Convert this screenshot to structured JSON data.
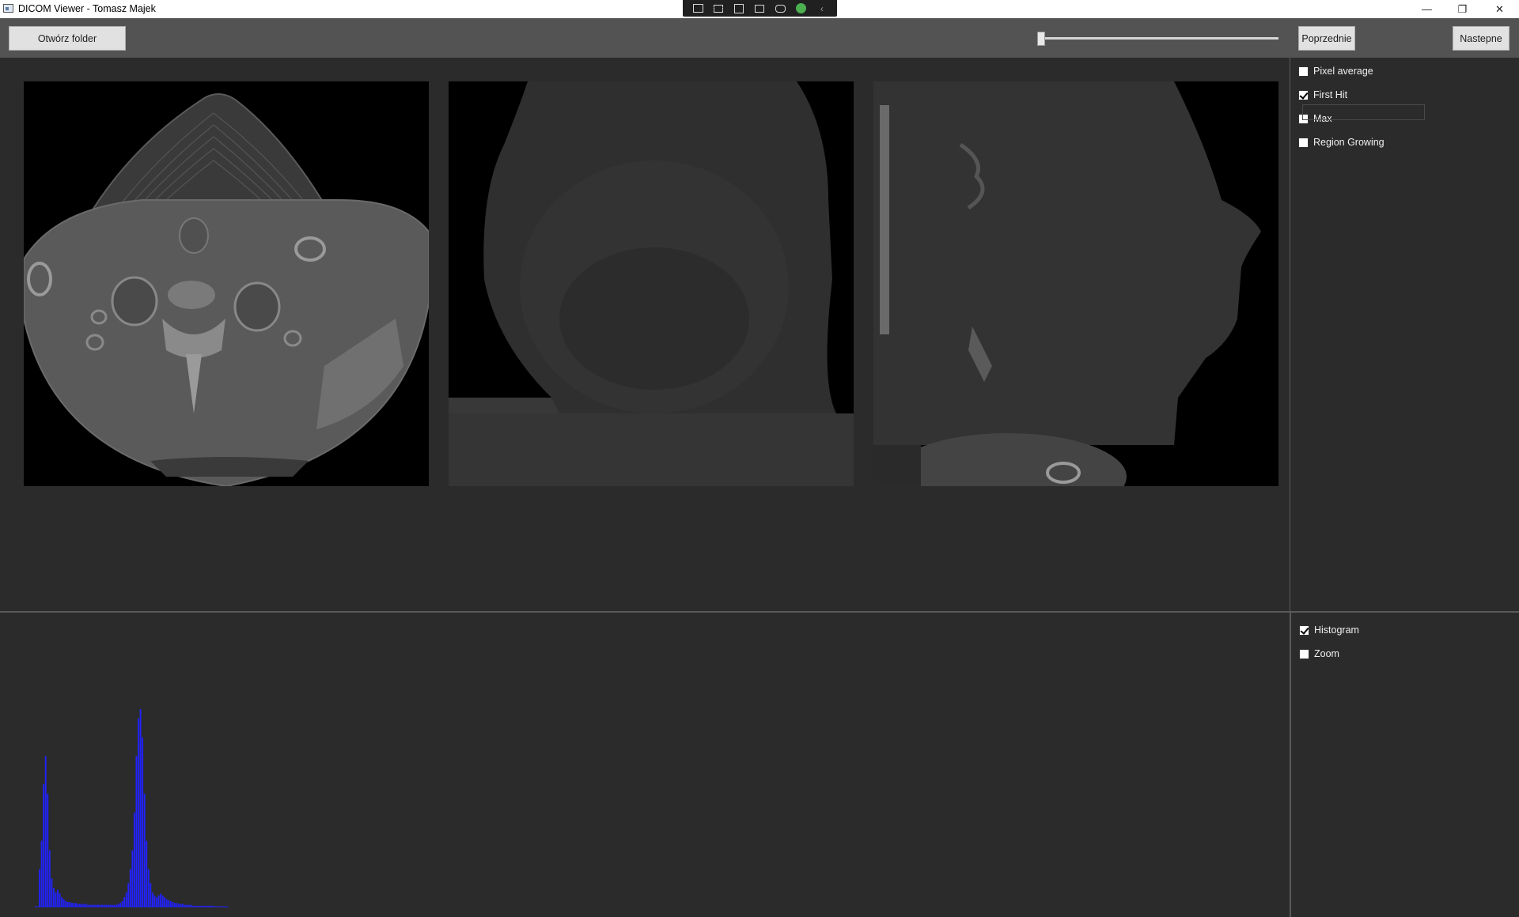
{
  "window": {
    "title": "DICOM Viewer - Tomasz Majek"
  },
  "toolbar": {
    "open_folder": "Otwórz folder",
    "previous": "Poprzednie",
    "next": "Nastepne",
    "slice_slider_value": 0.0
  },
  "render_modes": [
    {
      "label": "Pixel average",
      "checked": false
    },
    {
      "label": "First Hit",
      "checked": true
    },
    {
      "label": "Max",
      "checked": false
    },
    {
      "label": "Region Growing",
      "checked": false
    }
  ],
  "bottom_options": [
    {
      "label": "Histogram",
      "checked": true
    },
    {
      "label": "Zoom",
      "checked": false
    }
  ],
  "views": [
    "axial",
    "coronal",
    "sagittal"
  ],
  "colors": {
    "histogram": "#2222ff",
    "panel": "#2b2b2b",
    "toolbar": "#535353"
  },
  "chart_data": {
    "type": "bar",
    "title": "",
    "xlabel": "",
    "ylabel": "",
    "bins": [
      0,
      0,
      40,
      70,
      130,
      160,
      120,
      60,
      30,
      20,
      15,
      18,
      14,
      10,
      8,
      6,
      5,
      5,
      4,
      4,
      4,
      3,
      3,
      3,
      3,
      3,
      2,
      2,
      2,
      2,
      2,
      2,
      2,
      2,
      2,
      2,
      2,
      2,
      2,
      2,
      2,
      3,
      4,
      6,
      10,
      15,
      25,
      40,
      60,
      100,
      160,
      200,
      210,
      180,
      120,
      70,
      40,
      25,
      15,
      12,
      10,
      12,
      14,
      12,
      10,
      8,
      7,
      6,
      5,
      4,
      4,
      3,
      3,
      3,
      2,
      2,
      2,
      2,
      1,
      1,
      1,
      1,
      1,
      1,
      1,
      1,
      1,
      1,
      1,
      0,
      0,
      0,
      0,
      0,
      0,
      0
    ],
    "ylim": [
      0,
      210
    ]
  }
}
